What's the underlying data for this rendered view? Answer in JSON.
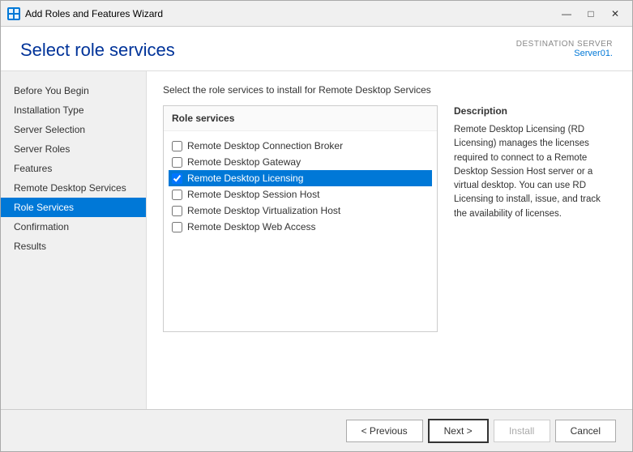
{
  "window": {
    "title": "Add Roles and Features Wizard"
  },
  "header": {
    "title": "Select role services",
    "destination_label": "DESTINATION SERVER",
    "server_name": "Server01."
  },
  "sidebar": {
    "items": [
      {
        "label": "Before You Begin",
        "active": false
      },
      {
        "label": "Installation Type",
        "active": false
      },
      {
        "label": "Server Selection",
        "active": false
      },
      {
        "label": "Server Roles",
        "active": false
      },
      {
        "label": "Features",
        "active": false
      },
      {
        "label": "Remote Desktop Services",
        "active": false
      },
      {
        "label": "Role Services",
        "active": true
      },
      {
        "label": "Confirmation",
        "active": false
      },
      {
        "label": "Results",
        "active": false
      }
    ]
  },
  "content": {
    "instruction": "Select the role services to install for Remote Desktop Services",
    "panel_header": "Role services",
    "role_services": [
      {
        "label": "Remote Desktop Connection Broker",
        "checked": false,
        "selected": false
      },
      {
        "label": "Remote Desktop Gateway",
        "checked": false,
        "selected": false
      },
      {
        "label": "Remote Desktop Licensing",
        "checked": true,
        "selected": true
      },
      {
        "label": "Remote Desktop Session Host",
        "checked": false,
        "selected": false
      },
      {
        "label": "Remote Desktop Virtualization Host",
        "checked": false,
        "selected": false
      },
      {
        "label": "Remote Desktop Web Access",
        "checked": false,
        "selected": false
      }
    ],
    "description_title": "Description",
    "description_text": "Remote Desktop Licensing (RD Licensing) manages the licenses required to connect to a Remote Desktop Session Host server or a virtual desktop. You can use RD Licensing to install, issue, and track the availability of licenses."
  },
  "footer": {
    "previous_label": "< Previous",
    "next_label": "Next >",
    "install_label": "Install",
    "cancel_label": "Cancel"
  },
  "title_bar_controls": {
    "minimize": "—",
    "maximize": "□",
    "close": "✕"
  }
}
